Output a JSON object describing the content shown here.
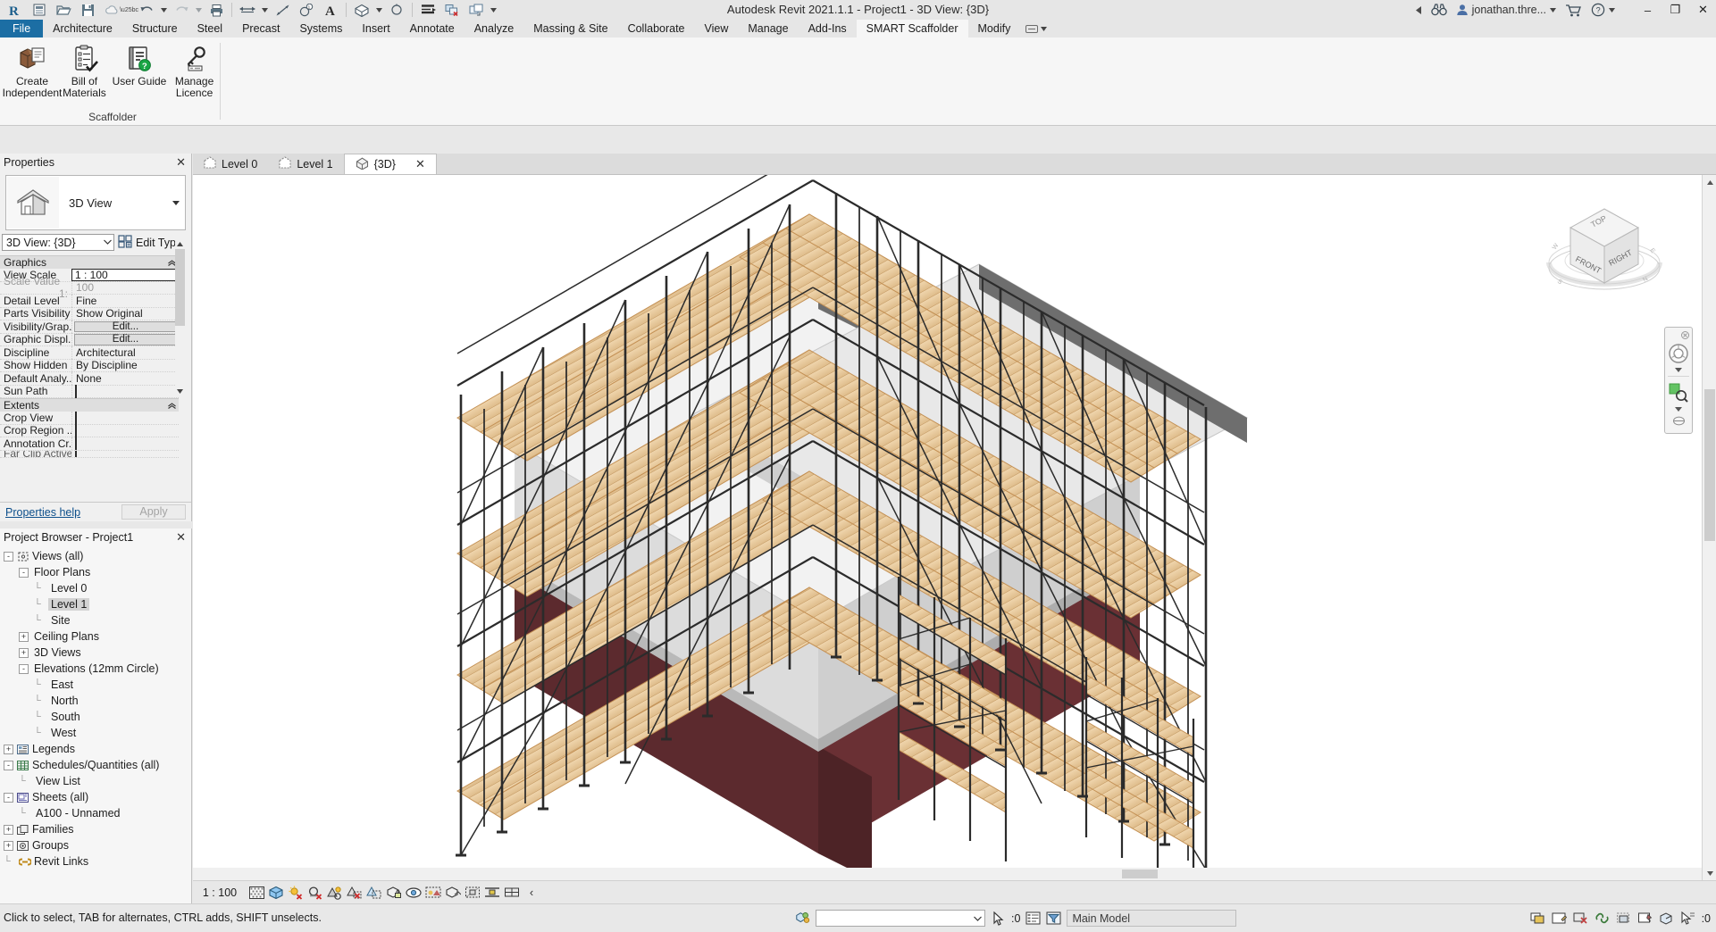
{
  "titlebar": {
    "title": "Autodesk Revit 2021.1.1 - Project1 - 3D View: {3D}",
    "user": "jonathan.thre...",
    "quick_access": [
      {
        "name": "revit-logo-icon",
        "label": "R"
      },
      {
        "name": "new-project-icon",
        "label": "New"
      },
      {
        "name": "open-folder-icon",
        "label": "Open"
      },
      {
        "name": "save-icon",
        "label": "Save"
      },
      {
        "name": "save-as-cloud-icon",
        "label": "Save As"
      },
      {
        "name": "undo-icon",
        "label": "Undo"
      },
      {
        "name": "redo-icon",
        "label": "Redo"
      },
      {
        "name": "print-icon",
        "label": "Print"
      },
      {
        "name": "measure-icon",
        "label": "Measure"
      },
      {
        "name": "aligned-dimension-icon",
        "label": "Aligned Dimension"
      },
      {
        "name": "tag-icon",
        "label": "Tag by Category"
      },
      {
        "name": "text-icon",
        "label": "Text"
      },
      {
        "name": "default-3d-view-icon",
        "label": "Default 3D View"
      },
      {
        "name": "section-icon",
        "label": "Section"
      },
      {
        "name": "thin-lines-icon",
        "label": "Thin Lines"
      },
      {
        "name": "close-hidden-windows-icon",
        "label": "Close Hidden Windows"
      },
      {
        "name": "switch-windows-icon",
        "label": "Switch Windows"
      }
    ],
    "window_buttons": {
      "minimize": "–",
      "restore": "❐",
      "close": "✕"
    }
  },
  "ribbon": {
    "tabs": [
      {
        "label": "File",
        "state": "file"
      },
      {
        "label": "Architecture",
        "state": "normal"
      },
      {
        "label": "Structure",
        "state": "normal"
      },
      {
        "label": "Steel",
        "state": "normal"
      },
      {
        "label": "Precast",
        "state": "normal"
      },
      {
        "label": "Systems",
        "state": "normal"
      },
      {
        "label": "Insert",
        "state": "normal"
      },
      {
        "label": "Annotate",
        "state": "normal"
      },
      {
        "label": "Analyze",
        "state": "normal"
      },
      {
        "label": "Massing & Site",
        "state": "normal"
      },
      {
        "label": "Collaborate",
        "state": "normal"
      },
      {
        "label": "View",
        "state": "normal"
      },
      {
        "label": "Manage",
        "state": "normal"
      },
      {
        "label": "Add-Ins",
        "state": "normal"
      },
      {
        "label": "SMART Scaffolder",
        "state": "active"
      },
      {
        "label": "Modify",
        "state": "normal"
      }
    ],
    "overflow_label": "▭",
    "panel": {
      "title": "Scaffolder",
      "items": [
        {
          "line1": "Create",
          "line2": "Independent",
          "icon": "create-independent-icon"
        },
        {
          "line1": "Bill of",
          "line2": "Materials",
          "icon": "bill-of-materials-icon"
        },
        {
          "line1": "User Guide",
          "line2": "",
          "icon": "user-guide-icon"
        },
        {
          "line1": "Manage",
          "line2": "Licence",
          "icon": "manage-licence-icon"
        }
      ]
    }
  },
  "properties": {
    "title": "Properties",
    "close_label": "✕",
    "type_preview_icon": "house-3d-view-icon",
    "type_name": "3D View",
    "type_dropdown_arrow": "▼",
    "type_selector": "3D View: {3D}",
    "edit_type_label": "Edit Type",
    "edit_type_icon": "edit-type-icon",
    "groups": [
      {
        "name": "Graphics",
        "collapse_icon": "«",
        "rows": [
          {
            "key": "View Scale",
            "value": "1 : 100",
            "kind": "boxed"
          },
          {
            "key": "Scale Value",
            "sub": "1:",
            "value": "100",
            "kind": "dim"
          },
          {
            "key": "Detail Level",
            "value": "Fine",
            "kind": "text"
          },
          {
            "key": "Parts Visibility",
            "value": "Show Original",
            "kind": "text"
          },
          {
            "key": "Visibility/Grap...",
            "value": "Edit...",
            "kind": "button"
          },
          {
            "key": "Graphic Displ...",
            "value": "Edit...",
            "kind": "button"
          },
          {
            "key": "Discipline",
            "value": "Architectural",
            "kind": "text"
          },
          {
            "key": "Show Hidden ...",
            "value": "By Discipline",
            "kind": "text"
          },
          {
            "key": "Default Analy...",
            "value": "None",
            "kind": "text"
          },
          {
            "key": "Sun Path",
            "value": "",
            "kind": "checkbox"
          }
        ]
      },
      {
        "name": "Extents",
        "collapse_icon": "«",
        "rows": [
          {
            "key": "Crop View",
            "value": "",
            "kind": "checkbox"
          },
          {
            "key": "Crop Region ...",
            "value": "",
            "kind": "checkbox"
          },
          {
            "key": "Annotation Cr...",
            "value": "",
            "kind": "checkbox"
          },
          {
            "key": "Far Clip Active",
            "value": "",
            "kind": "checkbox"
          }
        ]
      }
    ],
    "help_link": "Properties help",
    "apply_label": "Apply",
    "scroll_up": "▲",
    "scroll_down": "▼"
  },
  "browser": {
    "title": "Project Browser - Project1",
    "close_label": "✕",
    "nodes": [
      {
        "depth": 0,
        "toggle": "-",
        "icon": "views-all-icon",
        "label": "Views (all)",
        "selected": false
      },
      {
        "depth": 1,
        "toggle": "-",
        "icon": "",
        "label": "Floor Plans",
        "selected": false
      },
      {
        "depth": 2,
        "toggle": "",
        "icon": "",
        "label": "Level 0",
        "selected": false
      },
      {
        "depth": 2,
        "toggle": "",
        "icon": "",
        "label": "Level 1",
        "selected": true
      },
      {
        "depth": 2,
        "toggle": "",
        "icon": "",
        "label": "Site",
        "selected": false
      },
      {
        "depth": 1,
        "toggle": "+",
        "icon": "",
        "label": "Ceiling Plans",
        "selected": false
      },
      {
        "depth": 1,
        "toggle": "+",
        "icon": "",
        "label": "3D Views",
        "selected": false
      },
      {
        "depth": 1,
        "toggle": "-",
        "icon": "",
        "label": "Elevations (12mm Circle)",
        "selected": false
      },
      {
        "depth": 2,
        "toggle": "",
        "icon": "",
        "label": "East",
        "selected": false
      },
      {
        "depth": 2,
        "toggle": "",
        "icon": "",
        "label": "North",
        "selected": false
      },
      {
        "depth": 2,
        "toggle": "",
        "icon": "",
        "label": "South",
        "selected": false
      },
      {
        "depth": 2,
        "toggle": "",
        "icon": "",
        "label": "West",
        "selected": false
      },
      {
        "depth": 0,
        "toggle": "+",
        "icon": "legends-icon",
        "label": "Legends",
        "selected": false
      },
      {
        "depth": 0,
        "toggle": "-",
        "icon": "schedules-icon",
        "label": "Schedules/Quantities (all)",
        "selected": false
      },
      {
        "depth": 1,
        "toggle": "",
        "icon": "",
        "label": "View List",
        "selected": false
      },
      {
        "depth": 0,
        "toggle": "-",
        "icon": "sheets-icon",
        "label": "Sheets (all)",
        "selected": false
      },
      {
        "depth": 1,
        "toggle": "",
        "icon": "",
        "label": "A100 - Unnamed",
        "selected": false
      },
      {
        "depth": 0,
        "toggle": "+",
        "icon": "families-icon",
        "label": "Families",
        "selected": false
      },
      {
        "depth": 0,
        "toggle": "+",
        "icon": "groups-icon",
        "label": "Groups",
        "selected": false
      },
      {
        "depth": 0,
        "toggle": "",
        "icon": "revit-links-icon",
        "label": "Revit Links",
        "selected": false
      }
    ]
  },
  "view_tabs": [
    {
      "label": "Level 0",
      "icon": "floor-plan-icon",
      "active": false,
      "closable": false
    },
    {
      "label": "Level 1",
      "icon": "floor-plan-icon",
      "active": false,
      "closable": false
    },
    {
      "label": "{3D}",
      "icon": "house-3d-view-icon",
      "active": true,
      "closable": true,
      "close_label": "✕"
    }
  ],
  "canvas": {
    "viewcube": {
      "top": "TOP",
      "front": "FRONT",
      "right": "RIGHT"
    },
    "navbar": {
      "close_label": "⊗",
      "steering_wheel_icon": "steering-wheel-icon",
      "zoom_icon": "zoom-region-icon",
      "arrow": "▼",
      "bottom_icon": "pan-icon"
    },
    "model": {
      "description": "3D isometric view of an L-shaped two-storey building with full perimeter system scaffolding",
      "colors": {
        "standard_tube": "#2b2b2b",
        "timber_board": "#e8c89a",
        "timber_board_edge": "#b98b4e",
        "wall_brick": "#5c2a2e",
        "wall_render_light": "#e6e6e6",
        "roof_slab_top": "#efefef",
        "roof_slab_side": "#6e6e6e",
        "floor_slab": "#d5d5d5",
        "background": "#ffffff"
      }
    }
  },
  "view_control_bar": {
    "scale": "1 : 100",
    "icons": [
      {
        "name": "detail-level-fine-icon"
      },
      {
        "name": "visual-style-icon"
      },
      {
        "name": "sun-path-off-icon"
      },
      {
        "name": "shadows-off-icon"
      },
      {
        "name": "rendering-dialog-icon"
      },
      {
        "name": "crop-view-off-icon"
      },
      {
        "name": "show-crop-region-icon"
      },
      {
        "name": "lock-3d-view-icon"
      },
      {
        "name": "temporary-hide-isolate-icon"
      },
      {
        "name": "reveal-hidden-elements-icon"
      },
      {
        "name": "temporary-view-properties-icon"
      },
      {
        "name": "analytical-model-icon"
      },
      {
        "name": "constraints-icon"
      },
      {
        "name": "worksharing-display-icon"
      },
      {
        "name": "chevron-left-icon",
        "label": "‹"
      }
    ]
  },
  "status_bar": {
    "message": "Click to select, TAB for alternates, CTRL adds, SHIFT unselects.",
    "filter_icon": "model-filter-icon",
    "combo_value": "",
    "combo_arrow": "▼",
    "selection_icon": "select-cursor-icon",
    "selection_count": ":0",
    "props_toggle_icon": "properties-toggle-icon",
    "filter_toggle_icon": "filter-toggle-icon",
    "workset": "Main Model",
    "right_icons": [
      {
        "name": "design-option-icon"
      },
      {
        "name": "editable-only-icon"
      },
      {
        "name": "exclude-options-icon"
      },
      {
        "name": "select-links-icon"
      },
      {
        "name": "select-underlay-icon"
      },
      {
        "name": "select-pinned-icon"
      },
      {
        "name": "select-by-face-icon"
      },
      {
        "name": "drag-elements-icon"
      }
    ],
    "warning_count": ":0"
  }
}
